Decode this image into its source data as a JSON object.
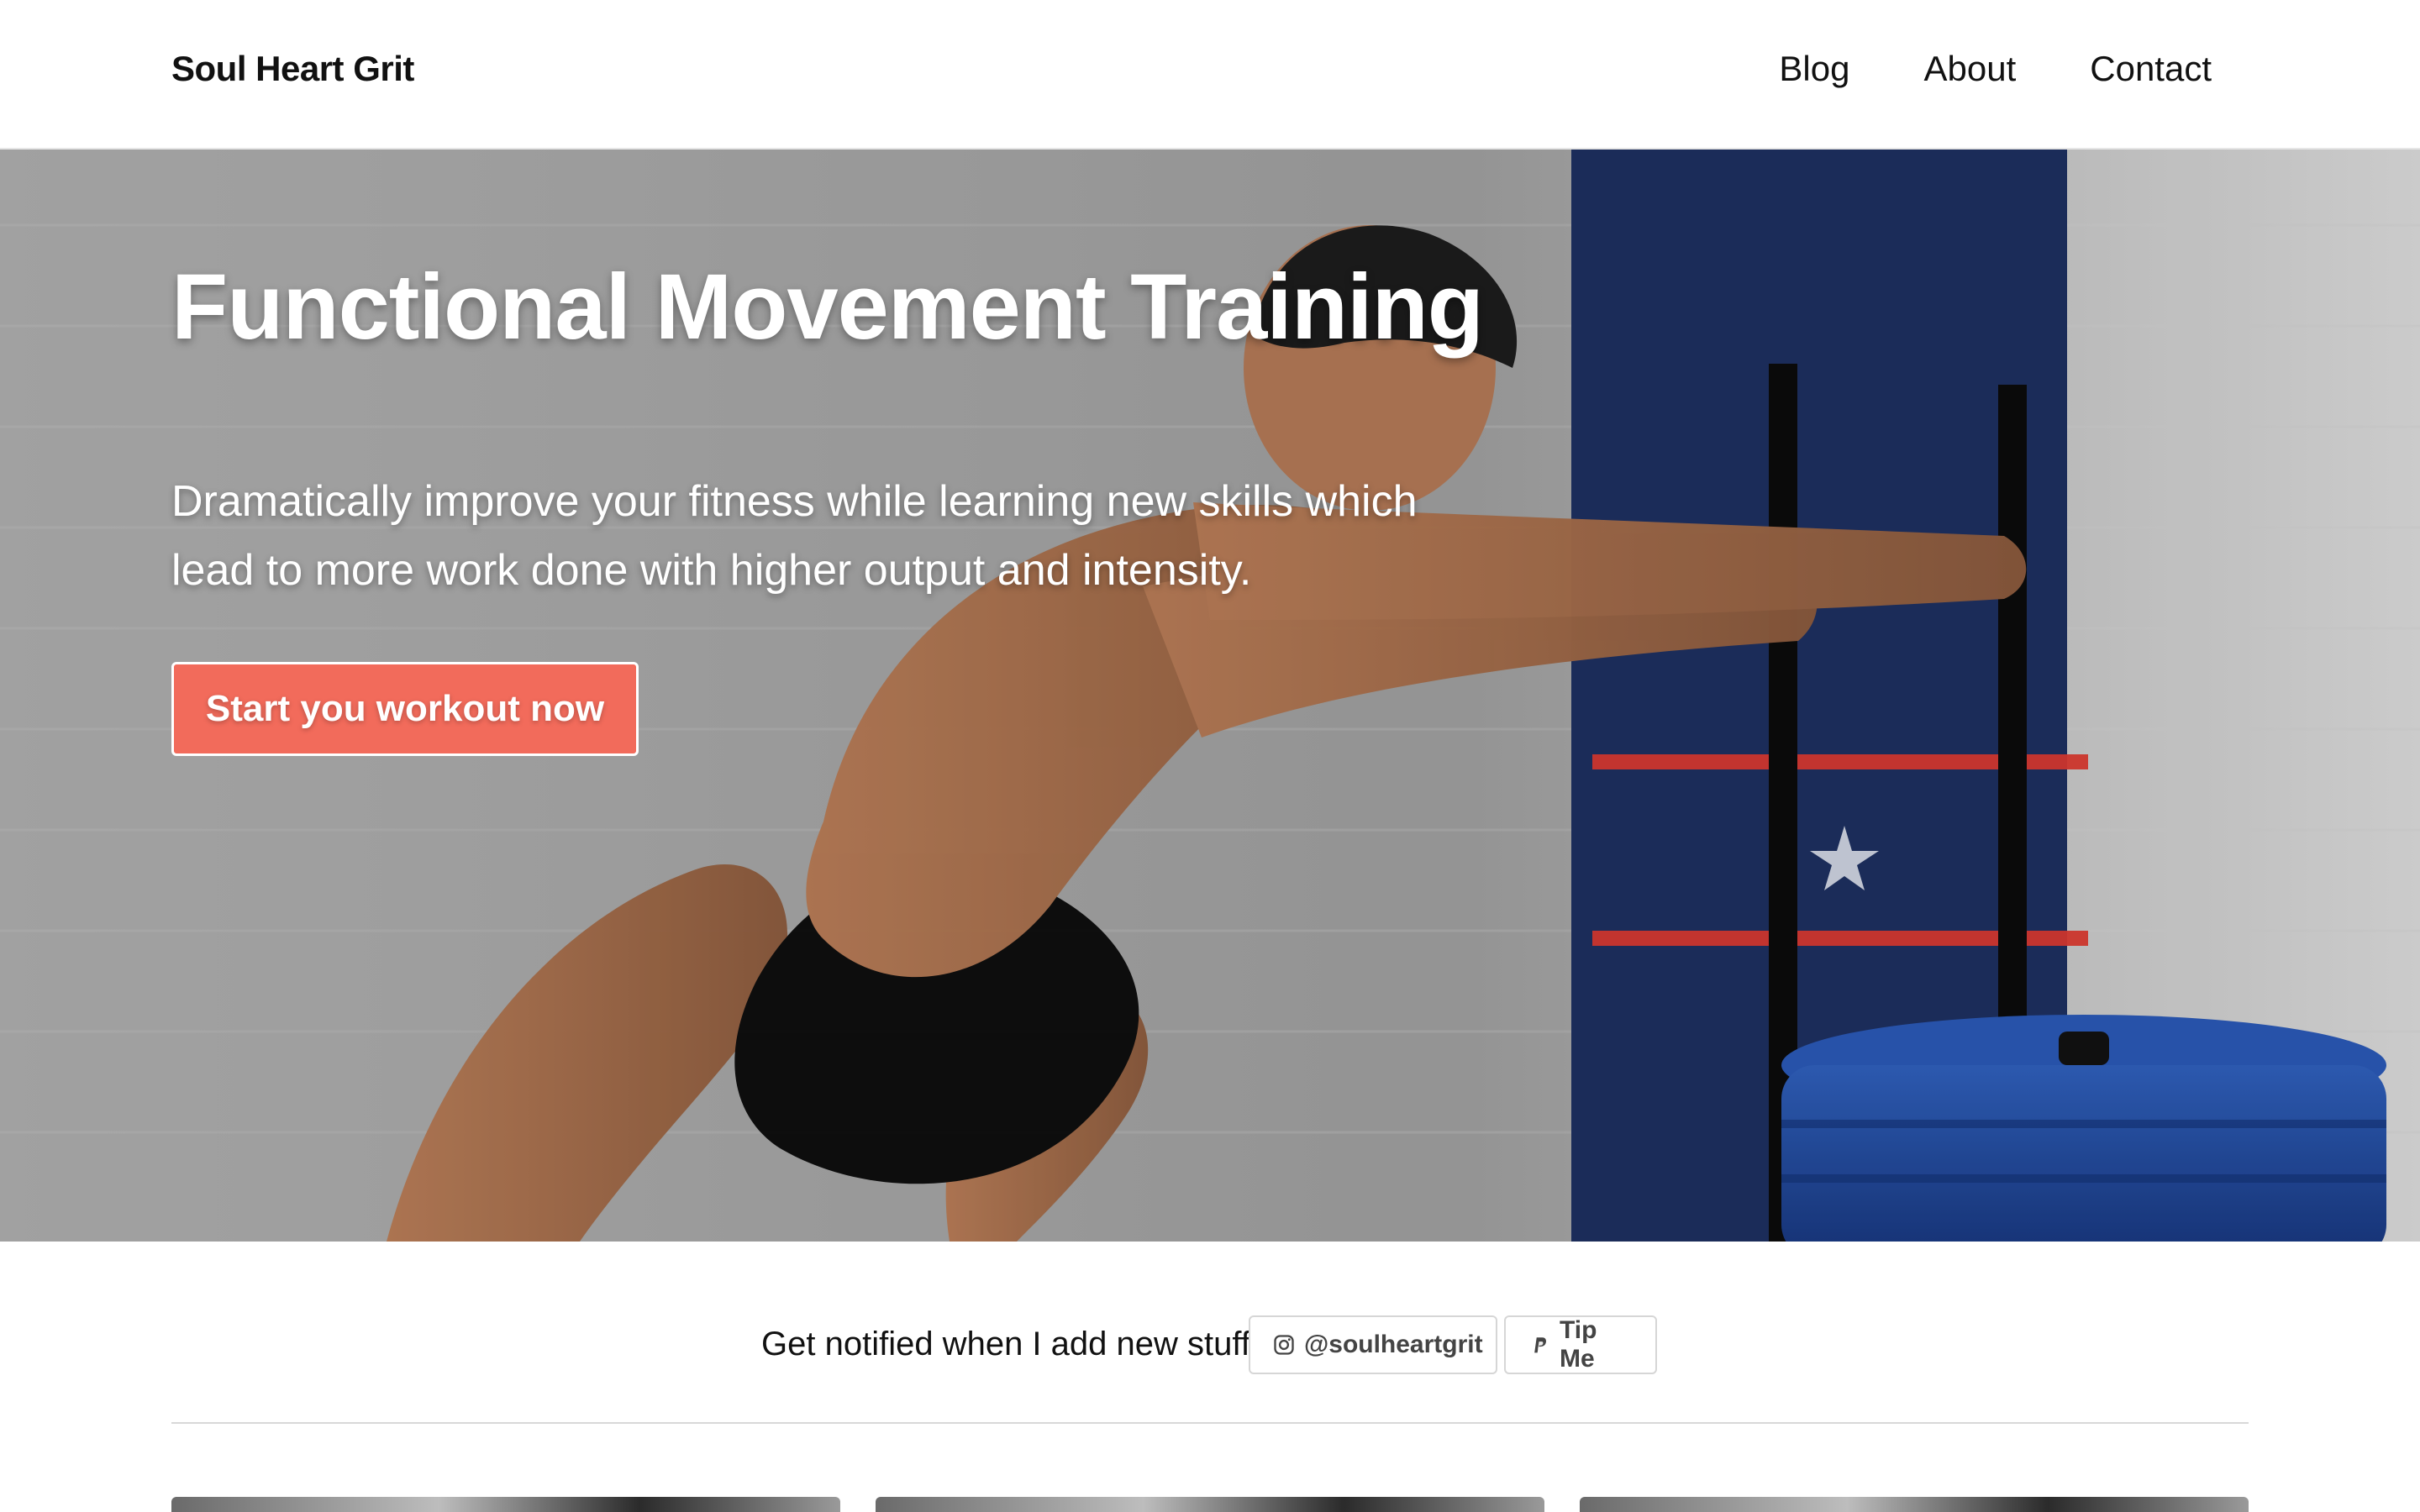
{
  "header": {
    "brand": "Soul Heart Grit",
    "nav": [
      "Blog",
      "About",
      "Contact"
    ]
  },
  "hero": {
    "title": "Functional Movement Training",
    "subtitle": "Dramatically improve your fitness while learning new skills which lead to more work done with higher output and intensity.",
    "cta": "Start you workout now"
  },
  "subscribe": {
    "label": "Get notified when I add new stuff",
    "instagram": "@soulheartgrit",
    "tip": "Tip Me"
  },
  "colors": {
    "accent": "#f26b5b",
    "text": "#111111",
    "border": "#d6d6d6"
  },
  "icons": {
    "instagram": "instagram-icon",
    "tip": "paypal-icon"
  }
}
